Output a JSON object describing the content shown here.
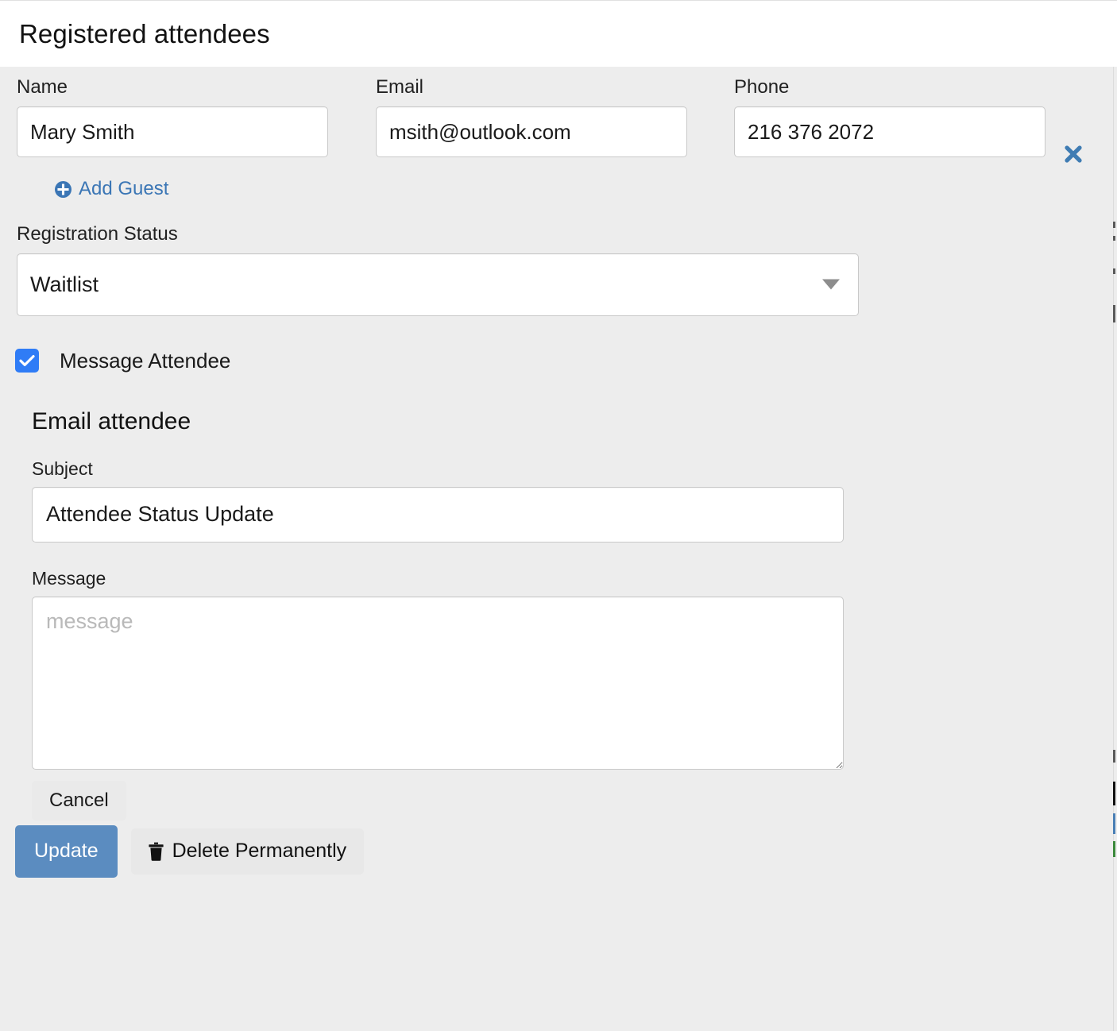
{
  "header": {
    "title": "Registered attendees",
    "close_icon": "close-x-icon"
  },
  "attendee": {
    "name": {
      "label": "Name",
      "value": "Mary Smith",
      "placeholder": "Name"
    },
    "email": {
      "label": "Email",
      "value": "msith@outlook.com",
      "placeholder": "Email"
    },
    "phone": {
      "label": "Phone",
      "value": "216 376 2072",
      "placeholder": "Phone"
    },
    "add_guest": {
      "label": "Add Guest",
      "icon": "plus-circle-icon"
    }
  },
  "registration": {
    "label": "Registration Status",
    "selected": "Waitlist",
    "options": [
      "Waitlist"
    ],
    "caret_icon": "chevron-down-icon"
  },
  "message_attendee": {
    "label": "Message Attendee",
    "checked": true
  },
  "email_section": {
    "title": "Email attendee",
    "subject": {
      "label": "Subject",
      "value": "Attendee Status Update",
      "placeholder": "subject"
    },
    "message": {
      "label": "Message",
      "value": "",
      "placeholder": "message"
    }
  },
  "footer": {
    "cancel_label": "Cancel",
    "update_label": "Update",
    "delete_label": "Delete Permanently",
    "delete_icon": "trash-icon"
  },
  "colors": {
    "accent_blue": "#3b76b5",
    "checkbox_blue": "#2f7cf6",
    "update_button": "#5b8cc0",
    "page_background": "#ededed",
    "panel_background": "#ffffff"
  }
}
